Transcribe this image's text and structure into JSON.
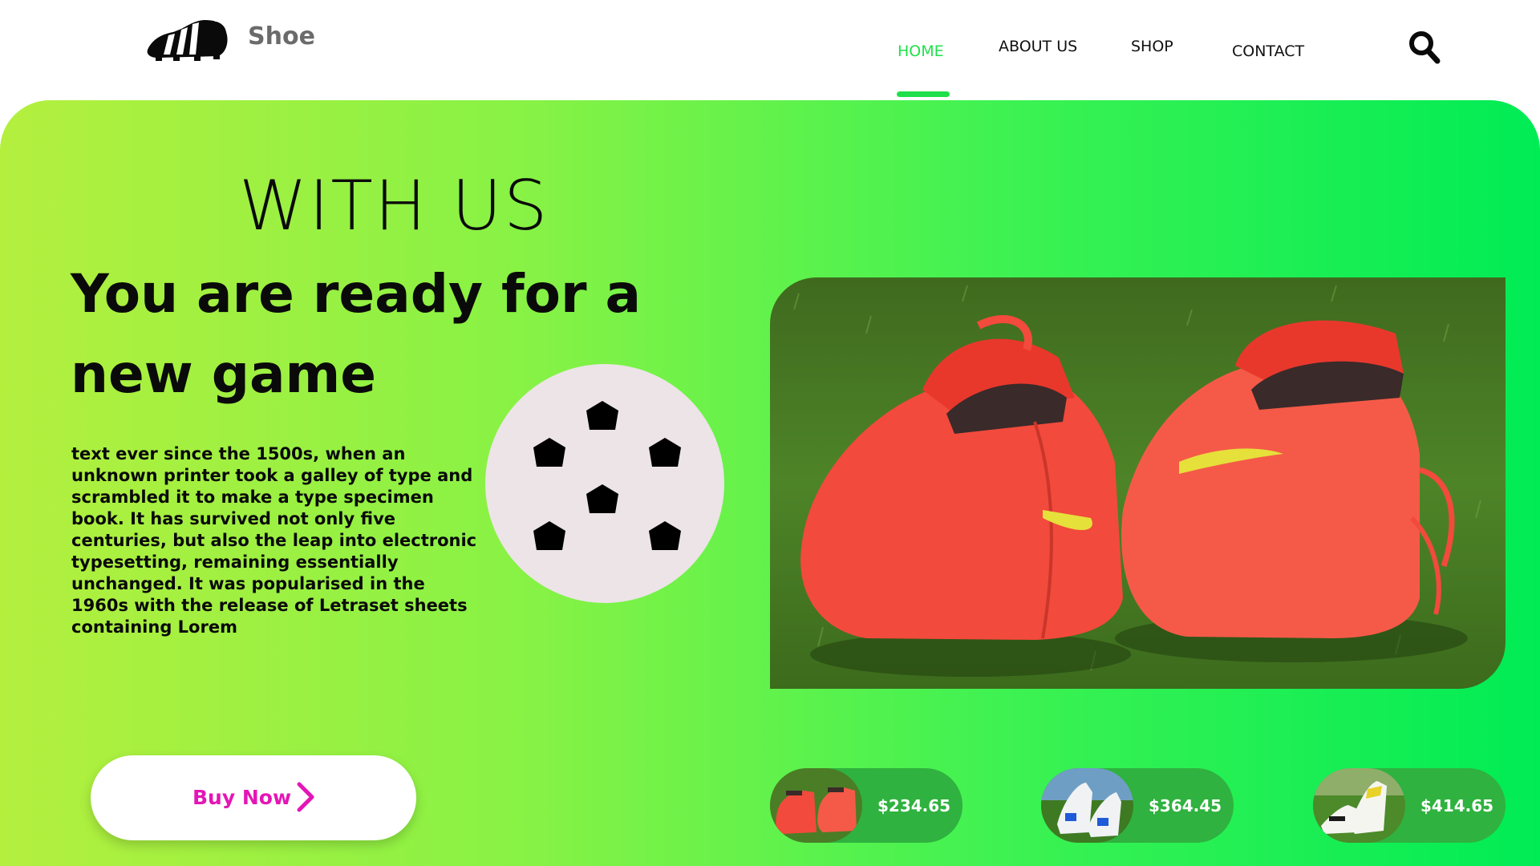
{
  "brand": {
    "name": "Shoe",
    "logo_icon": "cleat-logo-icon"
  },
  "nav": {
    "items": [
      {
        "label": "HOME",
        "active": true
      },
      {
        "label": "ABOUT US"
      },
      {
        "label": "SHOP"
      },
      {
        "label": "CONTACT"
      }
    ],
    "search_icon": "search-icon",
    "active_color": "#1fe04a"
  },
  "hero": {
    "eyebrow": "WITH US",
    "headline": "You are ready for a new game",
    "body": "text ever since the 1500s, when an unknown printer took a galley of type and scrambled it to make a type specimen book. It has survived not only five centuries, but also the leap into electronic typesetting, remaining essentially unchanged. It was popularised in the 1960s with the release of Letraset sheets containing Lorem",
    "cta_label": "Buy Now",
    "cta_color": "#e416b6",
    "gradient": [
      "#b4ef3e",
      "#00ec55"
    ]
  },
  "products": [
    {
      "price": "$234.65",
      "shoe": "red-cleats"
    },
    {
      "price": "$364.45",
      "shoe": "white-blue-cleats"
    },
    {
      "price": "$414.65",
      "shoe": "white-yellow-cleats"
    }
  ]
}
